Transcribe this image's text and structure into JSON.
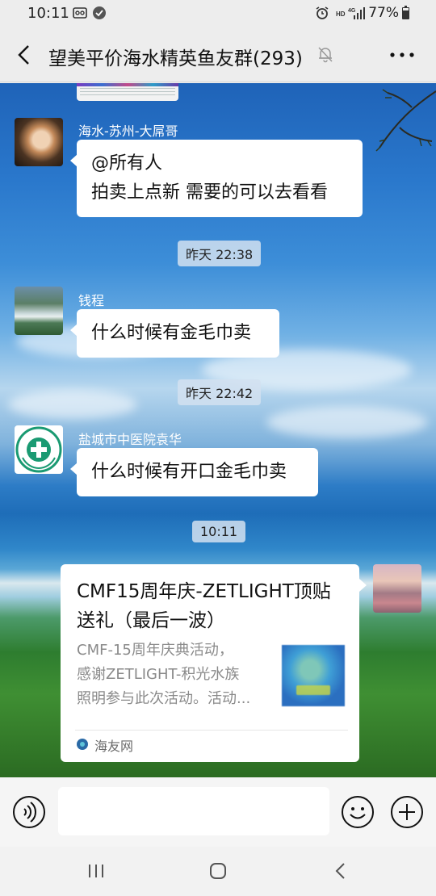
{
  "status_bar": {
    "time": "10:11",
    "battery_percent": "77%",
    "icons": [
      "voicemail-icon",
      "app-notification-icon",
      "alarm-icon",
      "hd-4g-signal-icon",
      "battery-icon"
    ]
  },
  "header": {
    "title": "望美平价海水精英鱼友群(293)",
    "back_icon": "chevron-left-icon",
    "mute_icon": "bell-off-icon",
    "more_icon": "more-dots-icon"
  },
  "messages": [
    {
      "sender": "海水-苏州-大屌哥",
      "lines": [
        "@所有人",
        "拍卖上点新 需要的可以去看看"
      ]
    },
    {
      "timestamp": "昨天 22:38"
    },
    {
      "sender": "钱程",
      "lines": [
        "什么时候有金毛巾卖"
      ]
    },
    {
      "timestamp": "昨天 22:42"
    },
    {
      "sender": "盐城市中医院袁华",
      "lines": [
        "什么时候有开口金毛巾卖"
      ]
    },
    {
      "timestamp": "10:11"
    },
    {
      "link_card": {
        "title": "CMF15周年庆-ZETLIGHT顶贴送礼（最后一波）",
        "description_lines": [
          "CMF-15周年庆典活动，",
          "感谢ZETLIGHT-积光水族",
          "照明参与此次活动。活动..."
        ],
        "source": "海友网"
      }
    }
  ],
  "input_bar": {
    "placeholder": "",
    "voice_icon": "voice-icon",
    "emoji_icon": "emoji-icon",
    "plus_icon": "plus-icon"
  },
  "nav_bar": {
    "icons": [
      "recent-apps-icon",
      "home-icon",
      "back-icon"
    ]
  },
  "colors": {
    "bubble": "#ffffff",
    "timestamp_bg": "#d2e1f0",
    "header_bg": "#ededed"
  }
}
